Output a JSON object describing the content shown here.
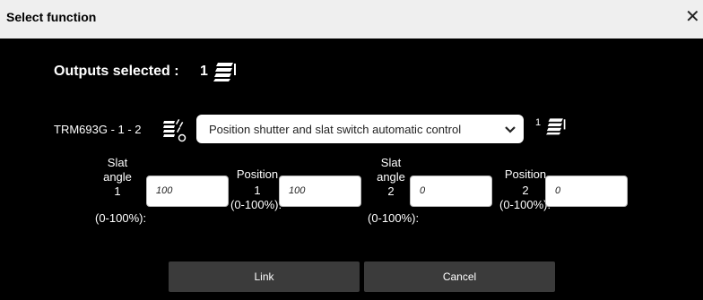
{
  "dialog": {
    "title": "Select function",
    "close_glyph": "✕"
  },
  "summary": {
    "label": "Outputs selected :",
    "count": "1",
    "icon": "stacked-outputs-icon"
  },
  "device": {
    "label": "TRM693G - 1 - 2",
    "icon": "shutter-output-icon",
    "function_selected": "Position shutter and slat switch automatic control",
    "output_count": "1"
  },
  "fields": {
    "slat1": {
      "l1": "Slat",
      "l2": "angle",
      "l3": "1",
      "l4": "(0-100%):",
      "value": "100"
    },
    "pos1": {
      "l1": "Position",
      "l2": "1",
      "l3": "(0-100%):",
      "value": "100"
    },
    "slat2": {
      "l1": "Slat",
      "l2": "angle",
      "l3": "2",
      "l4": "(0-100%):",
      "value": "0"
    },
    "pos2": {
      "l1": "Position",
      "l2": "2",
      "l3": "(0-100%):",
      "value": "0"
    }
  },
  "buttons": {
    "link": "Link",
    "cancel": "Cancel"
  },
  "colors": {
    "background": "#000000",
    "titlebar": "#efefef",
    "button": "#3b3b3b"
  }
}
